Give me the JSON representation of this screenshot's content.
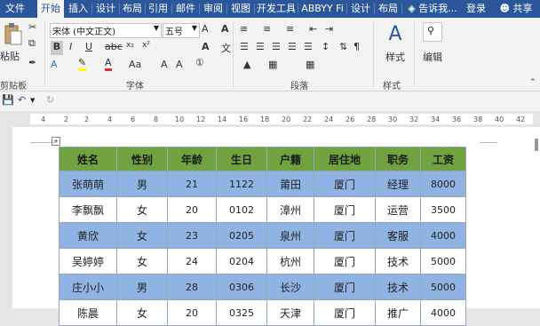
{
  "tabs": [
    "文件",
    "开始",
    "插入",
    "设计",
    "布局",
    "引用",
    "邮件",
    "审阅",
    "视图",
    "开发工具",
    "ABBYY Fi",
    "设计",
    "布局"
  ],
  "tell_me": "告诉我...",
  "login": "登录",
  "share": "共享",
  "clipboard": {
    "paste": "粘贴",
    "label": "剪贴板"
  },
  "font": {
    "name": "宋体 (中文正文)",
    "size": "五号",
    "label": "字体",
    "wen": "文",
    "A": "A",
    "Aa": "Aa",
    "grow": "A",
    "shrink": "A",
    "clear": "A"
  },
  "para": {
    "label": "段落"
  },
  "styles": {
    "label": "样式",
    "btn": "样式"
  },
  "edit": {
    "btn": "编辑"
  },
  "ruler_ticks": [
    "4",
    "2",
    "2",
    "4",
    "6",
    "8",
    "10",
    "12",
    "14",
    "16",
    "18",
    "20",
    "22",
    "24",
    "26",
    "28",
    "30",
    "32",
    "34",
    "36",
    "38",
    "40",
    "42"
  ],
  "table": {
    "headers": [
      "姓名",
      "性别",
      "年龄",
      "生日",
      "户籍",
      "居住地",
      "职务",
      "工资"
    ],
    "rows": [
      [
        "张萌萌",
        "男",
        "21",
        "1122",
        "莆田",
        "厦门",
        "经理",
        "8000"
      ],
      [
        "李飘飘",
        "女",
        "20",
        "0102",
        "漳州",
        "厦门",
        "运营",
        "3500"
      ],
      [
        "黄欣",
        "女",
        "23",
        "0205",
        "泉州",
        "厦门",
        "客服",
        "4000"
      ],
      [
        "吴婷婷",
        "女",
        "24",
        "0204",
        "杭州",
        "厦门",
        "技术",
        "5000"
      ],
      [
        "庄小小",
        "男",
        "28",
        "0306",
        "长沙",
        "厦门",
        "技术",
        "5000"
      ],
      [
        "陈晨",
        "女",
        "20",
        "0325",
        "天津",
        "厦门",
        "推广",
        "4000"
      ]
    ]
  },
  "colors": {
    "ribbon_blue": "#2b579a",
    "header_green": "#70a340",
    "row_blue": "#8fb4e3"
  }
}
